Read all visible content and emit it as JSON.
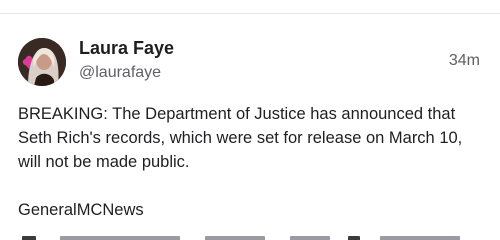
{
  "post": {
    "author_name": "Laura Faye",
    "author_handle": "@laurafaye",
    "timestamp": "34m",
    "paragraphs": [
      "BREAKING: The Department of Justice has announced that Seth Rich's records, which were set for release on March 10, will not be made public.",
      "GeneralMCNews"
    ],
    "avatar_icon": "profile-photo"
  }
}
